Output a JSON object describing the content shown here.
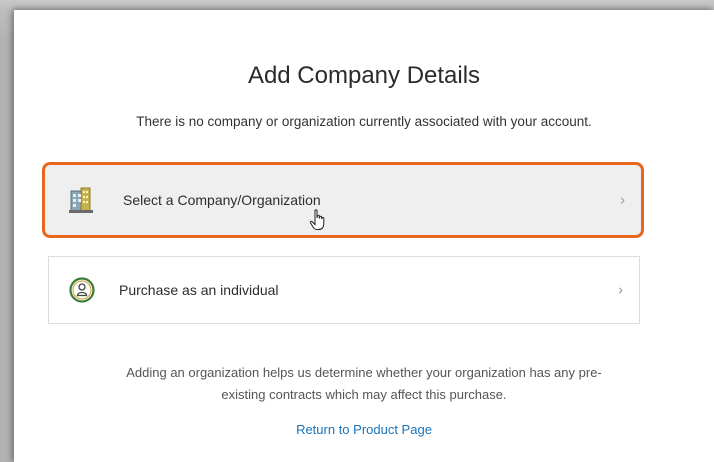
{
  "page": {
    "title": "Add Company Details",
    "subtitle": "There is no company or organization currently associated with your account."
  },
  "options": [
    {
      "label": "Select a Company/Organization",
      "icon": "building-icon",
      "chevron": "›",
      "selected": true
    },
    {
      "label": "Purchase as an individual",
      "icon": "person-icon",
      "chevron": "›",
      "selected": false
    }
  ],
  "note": {
    "line1": "Adding an organization helps us determine whether your organization has any pre-",
    "line2": "existing contracts which may affect this purchase."
  },
  "return_link": "Return to Product Page",
  "colors": {
    "highlight_border": "#e8661f",
    "link": "#1a73b8"
  }
}
